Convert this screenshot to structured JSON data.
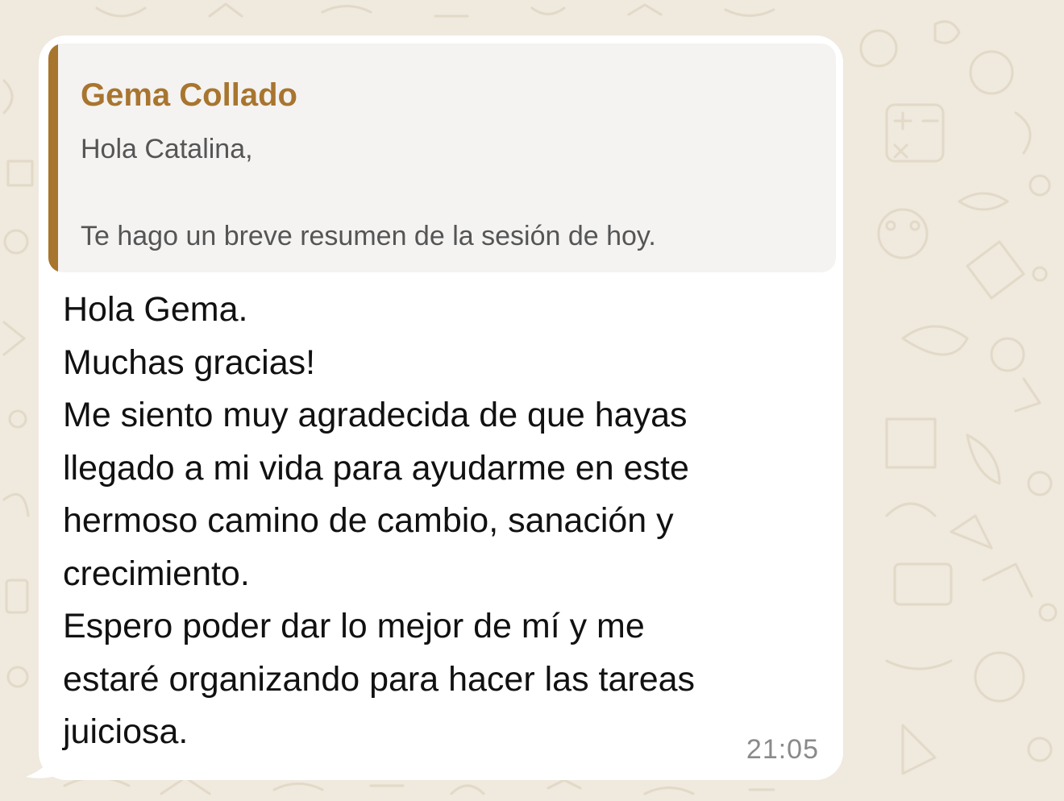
{
  "colors": {
    "chat_background": "#efe9de",
    "bubble_background": "#ffffff",
    "quote_background": "#f4f3f2",
    "quote_accent": "#a8752f",
    "message_text": "#111111",
    "quote_text": "#555555",
    "timestamp_text": "#8a8a8a"
  },
  "message": {
    "quoted": {
      "author": "Gema Collado",
      "lines": [
        "Hola Catalina,",
        "",
        "Te hago un breve resumen de la sesión de hoy."
      ]
    },
    "lines": [
      "Hola Gema.",
      "Muchas gracias!",
      "Me siento muy agradecida de que hayas",
      "llegado a mi vida para ayudarme en este",
      "hermoso camino de cambio, sanación y",
      "crecimiento.",
      "Espero poder dar lo mejor de mí y me",
      "estaré organizando para hacer las tareas",
      "juiciosa."
    ],
    "time": "21:05"
  }
}
